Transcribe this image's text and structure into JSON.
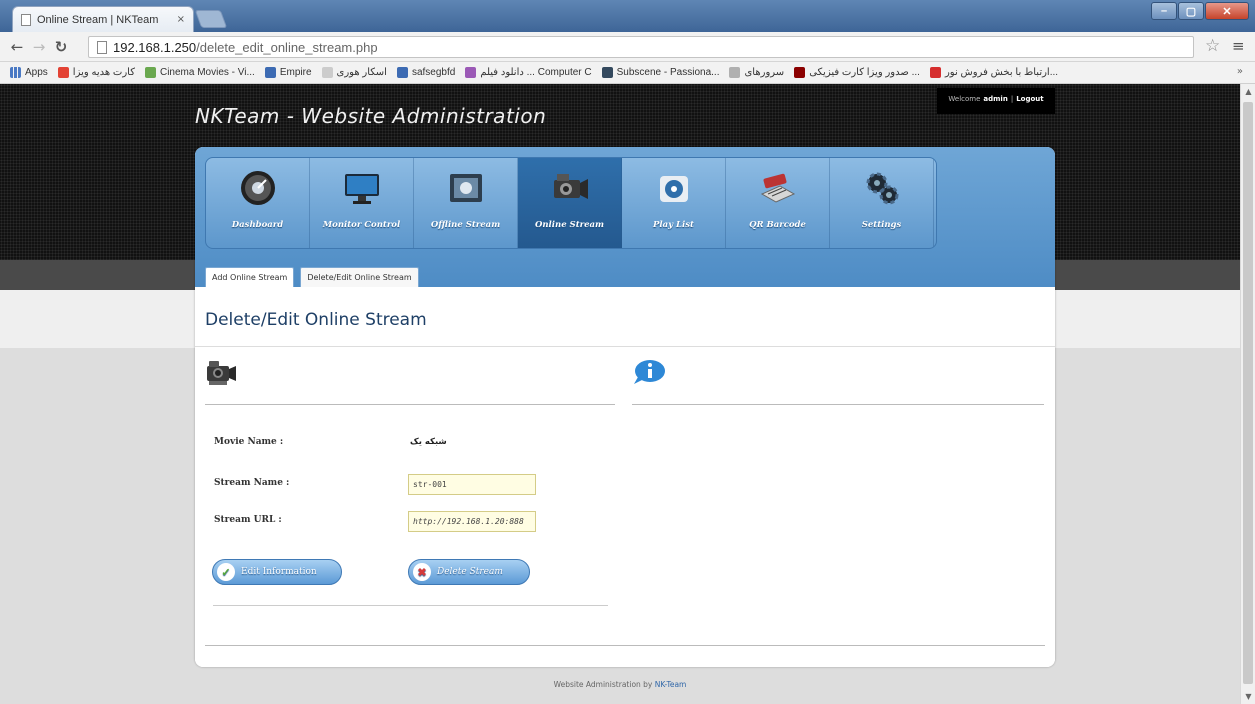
{
  "browser": {
    "tab_title": "Online Stream | NKTeam",
    "tab_close": "×",
    "url_host": "192.168.1.250",
    "url_path": "/delete_edit_online_stream.php",
    "bookmarks": [
      {
        "label": "Apps",
        "color": "#4a79c4"
      },
      {
        "label": "کارت هدیه ویزا",
        "color": "#e34234"
      },
      {
        "label": "Cinema Movies - Vi...",
        "color": "#6aa84f"
      },
      {
        "label": "Empire",
        "color": "#3d6bb3"
      },
      {
        "label": "اسکار هوری",
        "color": "#cccccc"
      },
      {
        "label": "safsegbfd",
        "color": "#3d6bb3"
      },
      {
        "label": "دانلود فیلم ... Computer C",
        "color": "#9b59b6"
      },
      {
        "label": "Subscene - Passiona...",
        "color": "#34495e"
      },
      {
        "label": "سرورهای",
        "color": "#b0b0b0"
      },
      {
        "label": "صدور ویزا کارت فیزیکی ...",
        "color": "#8b0000"
      },
      {
        "label": "ارتباط با بخش فروش نور...",
        "color": "#d62e2e"
      }
    ]
  },
  "header": {
    "site_title": "NKTeam - Website Administration",
    "welcome_prefix": "Welcome",
    "username": "admin",
    "separator": "|",
    "logout": "Logout"
  },
  "nav": {
    "items": [
      {
        "label": "Dashboard",
        "icon": "dashboard-icon"
      },
      {
        "label": "Monitor Control",
        "icon": "monitor-icon"
      },
      {
        "label": "Offline Stream",
        "icon": "offline-stream-icon"
      },
      {
        "label": "Online Stream",
        "icon": "online-stream-icon",
        "active": true
      },
      {
        "label": "Play List",
        "icon": "playlist-icon"
      },
      {
        "label": "QR Barcode",
        "icon": "qr-barcode-icon"
      },
      {
        "label": "Settings",
        "icon": "settings-icon"
      }
    ]
  },
  "subtabs": [
    {
      "label": "Add Online Stream"
    },
    {
      "label": "Delete/Edit Online Stream",
      "active": true
    }
  ],
  "content": {
    "heading": "Delete/Edit Online Stream",
    "movie_name_label": "Movie Name :",
    "movie_name_value": "شبکه یک",
    "stream_name_label": "Stream Name :",
    "stream_name_value": "str-001",
    "stream_url_label": "Stream URL :",
    "stream_url_value": "http://192.168.1.20:888",
    "edit_button": "Edit Information",
    "delete_button": "Delete Stream"
  },
  "footer": {
    "text": "Website Administration by",
    "brand": "NK-Team"
  },
  "colors": {
    "accent": "#4e8cc5",
    "heading": "#1e3f66",
    "active_nav": "#2f6fab"
  }
}
